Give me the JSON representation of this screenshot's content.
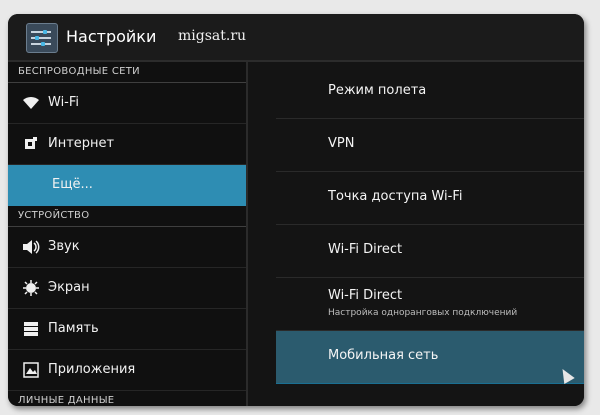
{
  "app": {
    "title": "Настройки",
    "watermark": "migsat.ru"
  },
  "sidebar": {
    "sections": {
      "wireless": "БЕСПРОВОДНЫЕ СЕТИ",
      "device": "УСТРОЙСТВО",
      "personal": "ЛИЧНЫЕ ДАННЫЕ"
    },
    "items": [
      {
        "label": "Wi-Fi",
        "icon": "wifi-icon"
      },
      {
        "label": "Интернет",
        "icon": "data-usage-icon"
      },
      {
        "label": "Ещё...",
        "icon": "",
        "selected": true
      },
      {
        "label": "Звук",
        "icon": "speaker-icon"
      },
      {
        "label": "Экран",
        "icon": "brightness-icon"
      },
      {
        "label": "Память",
        "icon": "storage-icon"
      },
      {
        "label": "Приложения",
        "icon": "apps-icon"
      }
    ],
    "selected_color": "#2e8db3"
  },
  "content": {
    "items": [
      {
        "title": "Режим полета"
      },
      {
        "title": "VPN"
      },
      {
        "title": "Точка доступа Wi-Fi"
      },
      {
        "title": "Wi-Fi Direct"
      },
      {
        "title": "Wi-Fi Direct",
        "subtitle": "Настройка одноранговых подключений"
      },
      {
        "title": "Мобильная сеть",
        "active": true
      }
    ]
  }
}
